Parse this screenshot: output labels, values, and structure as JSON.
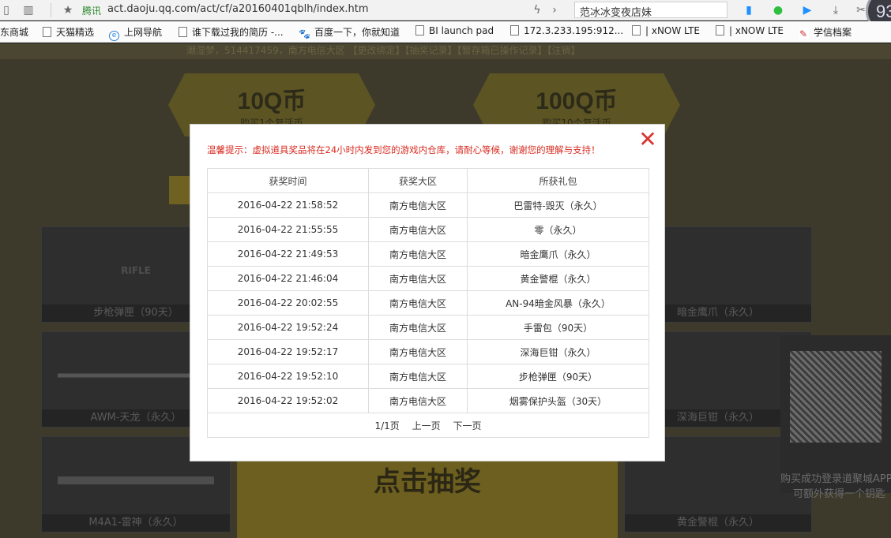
{
  "browser": {
    "tencent_label": "腾讯",
    "url": "act.daoju.qq.com/act/cf/a20160401qblh/index.htm",
    "search_value": "范冰冰变夜店妹",
    "avatar_text": "93"
  },
  "bookmarks": [
    {
      "label": "东商城"
    },
    {
      "label": "天猫精选"
    },
    {
      "label": "上网导航"
    },
    {
      "label": "谁下载过我的简历 -..."
    },
    {
      "label": "百度一下，你就知道"
    },
    {
      "label": "BI launch pad"
    },
    {
      "label": "172.3.233.195:912..."
    },
    {
      "label": "| xNOW LTE"
    },
    {
      "label": "| xNOW LTE"
    },
    {
      "label": "学信档案"
    }
  ],
  "background": {
    "top_strip": "潮湿梦，514417459，南方电信大区 【更改绑定】【抽奖记录】【暂存箱已操作记录】【注销】",
    "prize_10": {
      "big": "10Q币",
      "small": "购买1个复活币"
    },
    "prize_100": {
      "big": "100Q币",
      "small": "购买10个复活币"
    },
    "cards": [
      {
        "label": "步枪弹匣（90天）",
        "art": "RIFLE"
      },
      {
        "label": "AWM-天龙（永久）",
        "art": ""
      },
      {
        "label": "M4A1-雷神（永久）",
        "art": ""
      },
      {
        "label": "暗金鹰爪（永久）",
        "art": ""
      },
      {
        "label": "深海巨钳（永久）",
        "art": ""
      },
      {
        "label": "黄金警棍（永久）",
        "art": ""
      }
    ],
    "draw_button": "点击抽奖",
    "qr_text_1": "购买成功登录道聚城APP",
    "qr_text_2": "可额外获得一个钥匙"
  },
  "modal": {
    "close_symbol": "✕",
    "tip": "温馨提示：虚拟道具奖品将在24小时内发到您的游戏内仓库，请耐心等候，谢谢您的理解与支持！",
    "headers": [
      "获奖时间",
      "获奖大区",
      "所获礼包"
    ],
    "rows": [
      [
        "2016-04-22 21:58:52",
        "南方电信大区",
        "巴雷特-毁灭（永久）"
      ],
      [
        "2016-04-22 21:55:55",
        "南方电信大区",
        "零（永久）"
      ],
      [
        "2016-04-22 21:49:53",
        "南方电信大区",
        "暗金鹰爪（永久）"
      ],
      [
        "2016-04-22 21:46:04",
        "南方电信大区",
        "黄金警棍（永久）"
      ],
      [
        "2016-04-22 20:02:55",
        "南方电信大区",
        "AN-94暗金风暴（永久）"
      ],
      [
        "2016-04-22 19:52:24",
        "南方电信大区",
        "手雷包（90天）"
      ],
      [
        "2016-04-22 19:52:17",
        "南方电信大区",
        "深海巨钳（永久）"
      ],
      [
        "2016-04-22 19:52:10",
        "南方电信大区",
        "步枪弹匣（90天）"
      ],
      [
        "2016-04-22 19:52:02",
        "南方电信大区",
        "烟雾保护头盔（30天）"
      ]
    ],
    "pager": {
      "page_info": "1/1页",
      "prev": "上一页",
      "next": "下一页"
    }
  }
}
